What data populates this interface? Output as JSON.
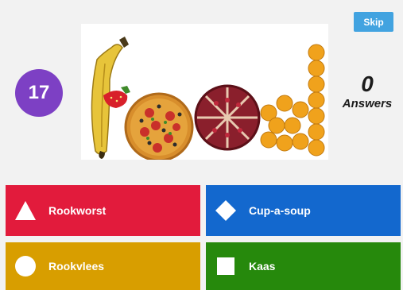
{
  "skip_label": "Skip",
  "timer_value": "17",
  "answers": {
    "count": "0",
    "label": "Answers"
  },
  "image": {
    "text": "food"
  },
  "choices": [
    {
      "label": "Rookworst",
      "color": "#e21b3c",
      "icon": "triangle-icon"
    },
    {
      "label": "Cup-a-soup",
      "color": "#1368ce",
      "icon": "diamond-icon"
    },
    {
      "label": "Rookvlees",
      "color": "#d89e00",
      "icon": "circle-icon"
    },
    {
      "label": "Kaas",
      "color": "#26890c",
      "icon": "square-icon"
    }
  ]
}
